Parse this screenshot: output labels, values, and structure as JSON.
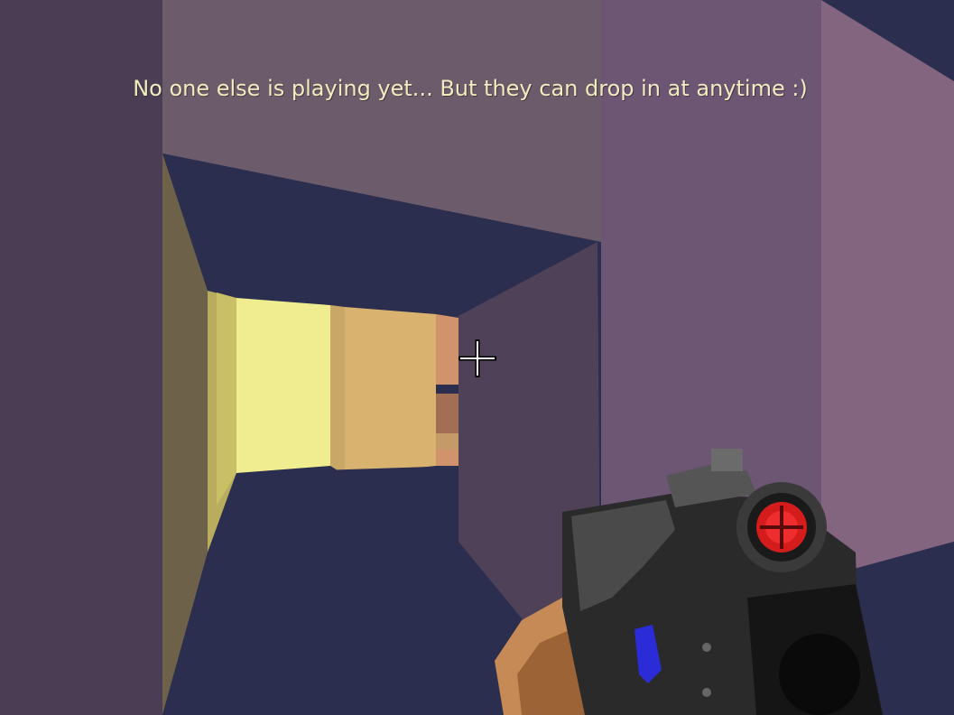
{
  "hud": {
    "message": "No one else is playing yet...  But they can drop in at anytime :)"
  },
  "scene": {
    "floor_color": "#2b2e4e",
    "ceiling_color": "#2b2e4e",
    "wall_colors": [
      "#4a3d54",
      "#6c5b6a",
      "#6d5574",
      "#84657f",
      "#4f4258",
      "#6d6249",
      "#f0ed91",
      "#d9b26f",
      "#d1936c"
    ]
  },
  "crosshair": {
    "icon": "crosshair-icon"
  },
  "weapon": {
    "icon": "plasma-gun-icon",
    "scope_color": "#d41c1c",
    "body_color": "#2a2a2a",
    "accent_color": "#2b2bd8",
    "hand_color": "#c58a55"
  }
}
